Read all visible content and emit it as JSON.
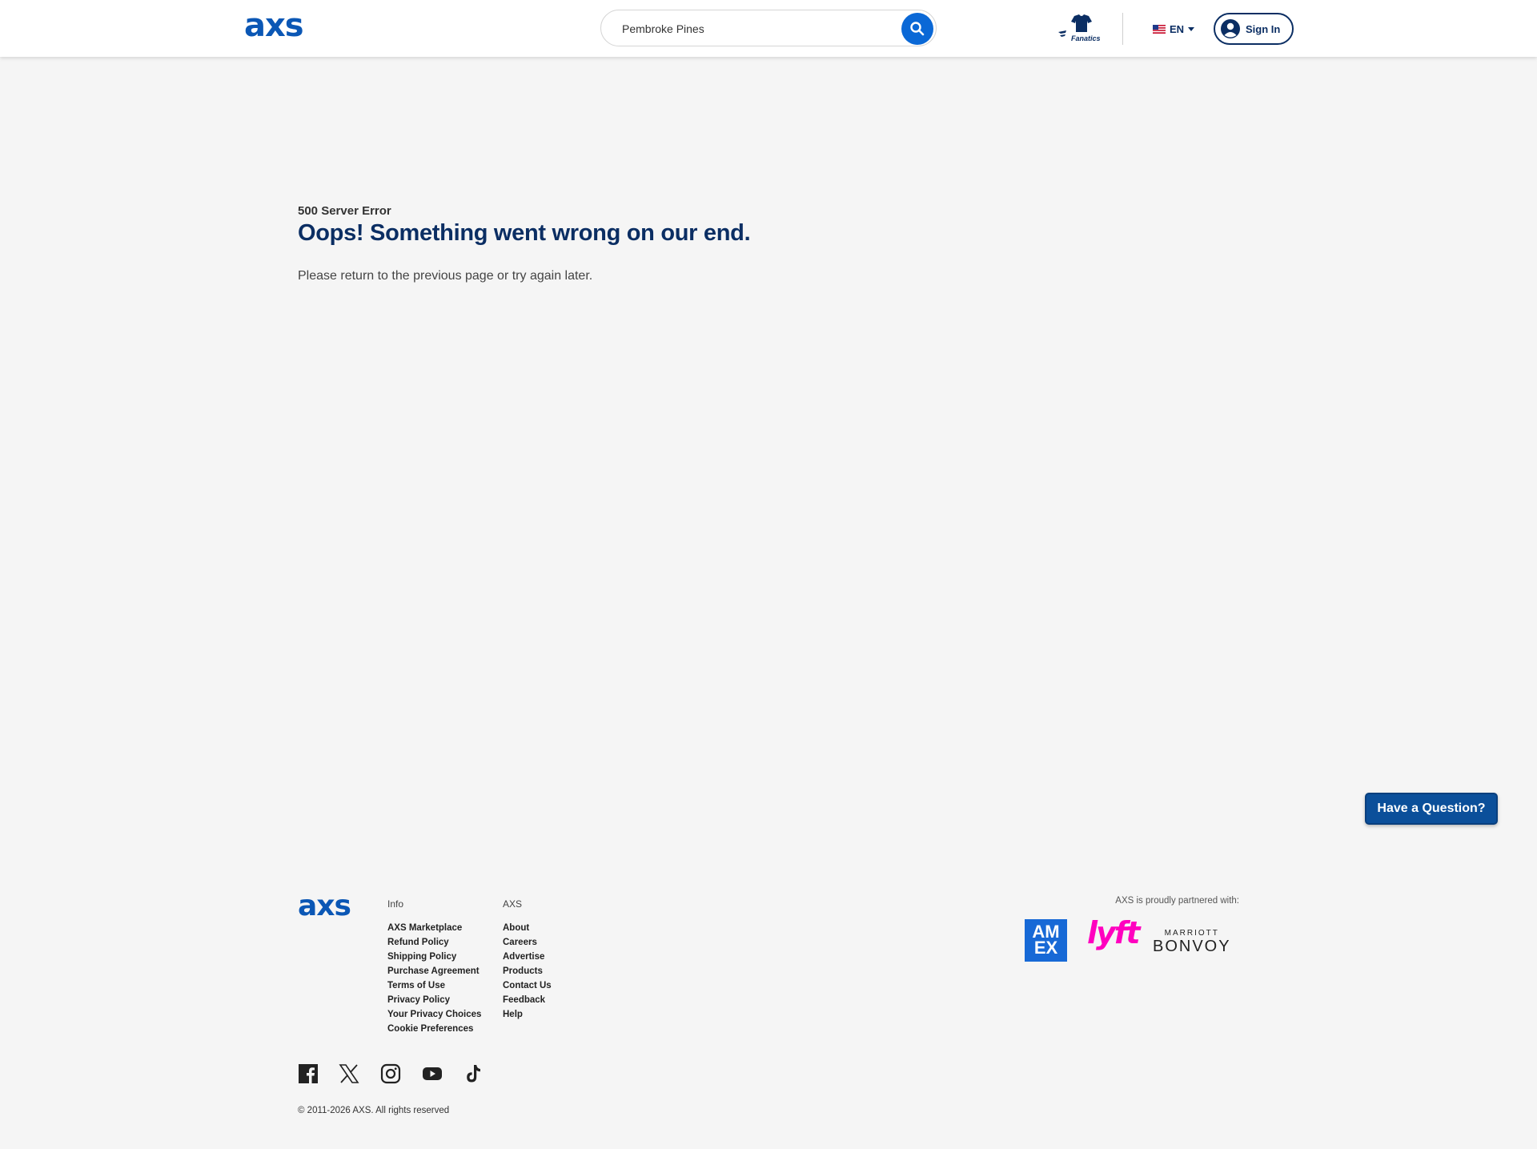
{
  "header": {
    "logo_text": "axs",
    "search": {
      "value": "Pembroke Pines",
      "placeholder": ""
    },
    "fanatics_label": "Fanatics",
    "language": "EN",
    "signin_label": "Sign In"
  },
  "error": {
    "code": "500 Server Error",
    "title": "Oops! Something went wrong on our end.",
    "description": "Please return to the previous page or try again later."
  },
  "help_button": "Have a Question?",
  "footer": {
    "logo_text": "axs",
    "info": {
      "heading": "Info",
      "links": [
        "AXS Marketplace",
        "Refund Policy",
        "Shipping Policy",
        "Purchase Agreement",
        "Terms of Use",
        "Privacy Policy",
        "Your Privacy Choices",
        "Cookie Preferences"
      ]
    },
    "axs": {
      "heading": "AXS",
      "links": [
        "About",
        "Careers",
        "Advertise",
        "Products",
        "Contact Us",
        "Feedback",
        "Help"
      ]
    },
    "partners": {
      "text": "AXS is proudly partnered with:",
      "amex_line1": "AM",
      "amex_line2": "EX",
      "lyft": "lyft",
      "marriott": "MARRIOTT",
      "bonvoy": "BONVOY"
    },
    "social_icons": [
      "facebook-icon",
      "x-icon",
      "instagram-icon",
      "youtube-icon",
      "tiktok-icon"
    ],
    "copyright": "© 2011-2026 AXS. All rights reserved"
  },
  "colors": {
    "brand_blue": "#0b57b5",
    "navy": "#0b2e63",
    "search_button": "#0a68d6",
    "help_button": "#0b4f9a",
    "lyft_pink": "#ff00bf",
    "amex_blue": "#1769d6",
    "background": "#f5f5f5"
  }
}
